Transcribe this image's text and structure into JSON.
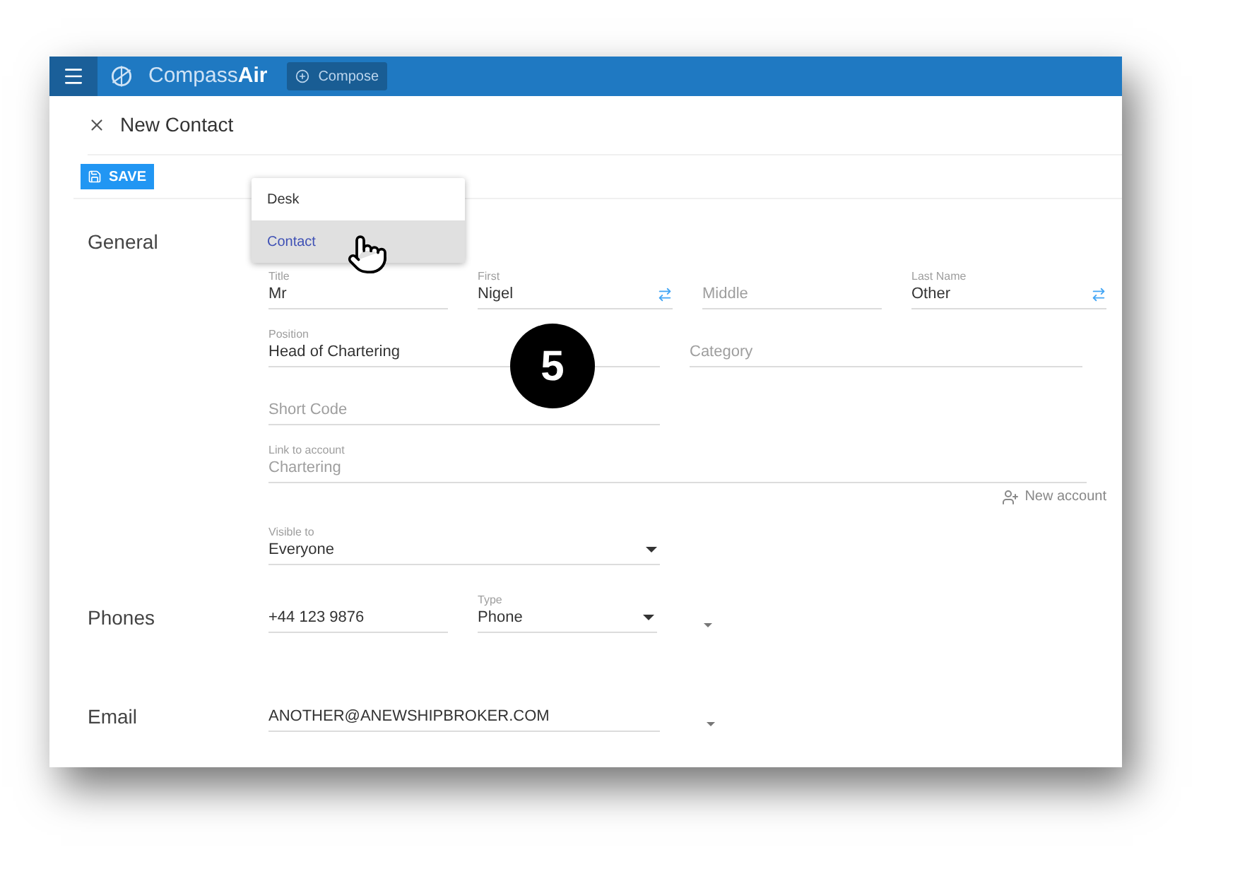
{
  "header": {
    "brand_light": "Compass",
    "brand_bold": "Air",
    "compose": "Compose"
  },
  "dialog": {
    "title": "New Contact",
    "save": "SAVE"
  },
  "menu": {
    "items": [
      {
        "label": "Desk",
        "selected": false
      },
      {
        "label": "Contact",
        "selected": true
      }
    ]
  },
  "step_badge": "5",
  "sections": [
    {
      "title": "General",
      "rows": [
        {
          "fields": [
            {
              "kind": "text",
              "label": "Title",
              "value": "Mr"
            },
            {
              "kind": "swap",
              "label": "First",
              "value": "Nigel"
            },
            {
              "kind": "placeholder",
              "placeholder": "Middle"
            },
            {
              "kind": "swap",
              "label": "Last Name",
              "value": "Other"
            }
          ]
        },
        {
          "fields": [
            {
              "kind": "text",
              "label": "Position",
              "value": "Head of Chartering"
            },
            {
              "kind": "placeholder",
              "placeholder": "Category"
            }
          ]
        },
        {
          "fields": [
            {
              "kind": "placeholder",
              "placeholder": "Short Code"
            }
          ]
        },
        {
          "fields": [
            {
              "kind": "lookup",
              "label": "Link to account",
              "placeholder": "Chartering"
            }
          ],
          "action": "New account"
        },
        {
          "fields": [
            {
              "kind": "select",
              "label": "Visible to",
              "value": "Everyone"
            }
          ]
        }
      ]
    },
    {
      "title": "Phones",
      "rows": [
        {
          "fields": [
            {
              "kind": "text",
              "value": "+44 123 9876"
            },
            {
              "kind": "select",
              "label": "Type",
              "value": "Phone"
            }
          ],
          "extra_caret": true
        }
      ]
    },
    {
      "title": "Email",
      "rows": [
        {
          "fields": [
            {
              "kind": "text",
              "value": "ANOTHER@ANEWSHIPBROKER.COM"
            }
          ],
          "extra_caret": true
        }
      ]
    }
  ]
}
